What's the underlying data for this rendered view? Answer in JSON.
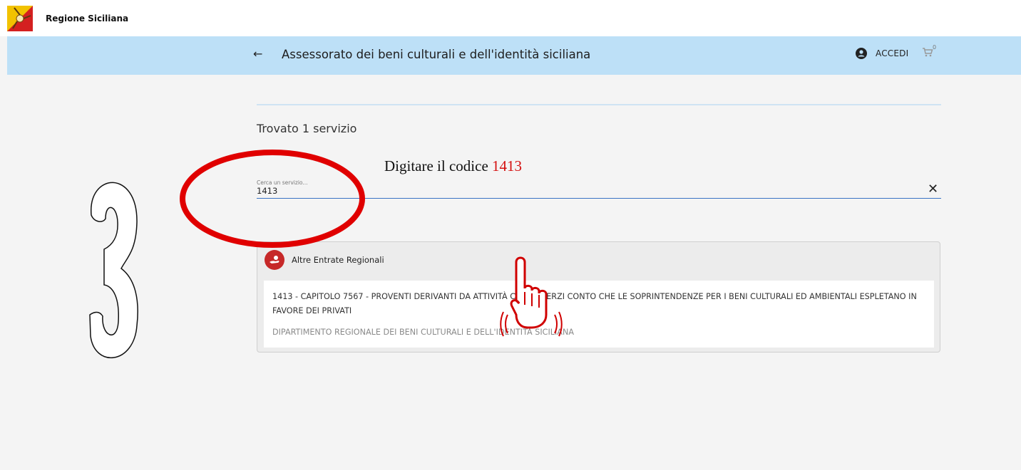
{
  "topbar": {
    "region_name": "Regione Siciliana",
    "logo_icon": "trinacria-logo"
  },
  "header": {
    "back_icon": "arrow-left-icon",
    "back_glyph": "←",
    "title": "Assessorato dei beni culturali e dell'identità siciliana",
    "login_label": "ACCEDI",
    "cart_count": "0",
    "background": "#bde0f7"
  },
  "main": {
    "results_count": "Trovato 1 servizio",
    "search": {
      "label": "Cerca un servizio...",
      "value": "1413"
    },
    "clear_glyph": "✕"
  },
  "results": [
    {
      "category": "Altre Entrate Regionali",
      "title": "1413 - CAPITOLO 7567 - PROVENTI DERIVANTI DA ATTIVITÀ CONTO TERZI CONTO CHE LE SOPRINTENDENZE PER I BENI CULTURALI ED AMBIENTALI ESPLETANO IN FAVORE DEI PRIVATI",
      "department": "DIPARTIMENTO REGIONALE DEI BENI CULTURALI E DELL'IDENTITÀ SICILIANA"
    }
  ],
  "annotation": {
    "instruction_text": "Digitare il codice ",
    "instruction_code": "1413",
    "step_number": "3",
    "highlight_color": "#e00000"
  }
}
